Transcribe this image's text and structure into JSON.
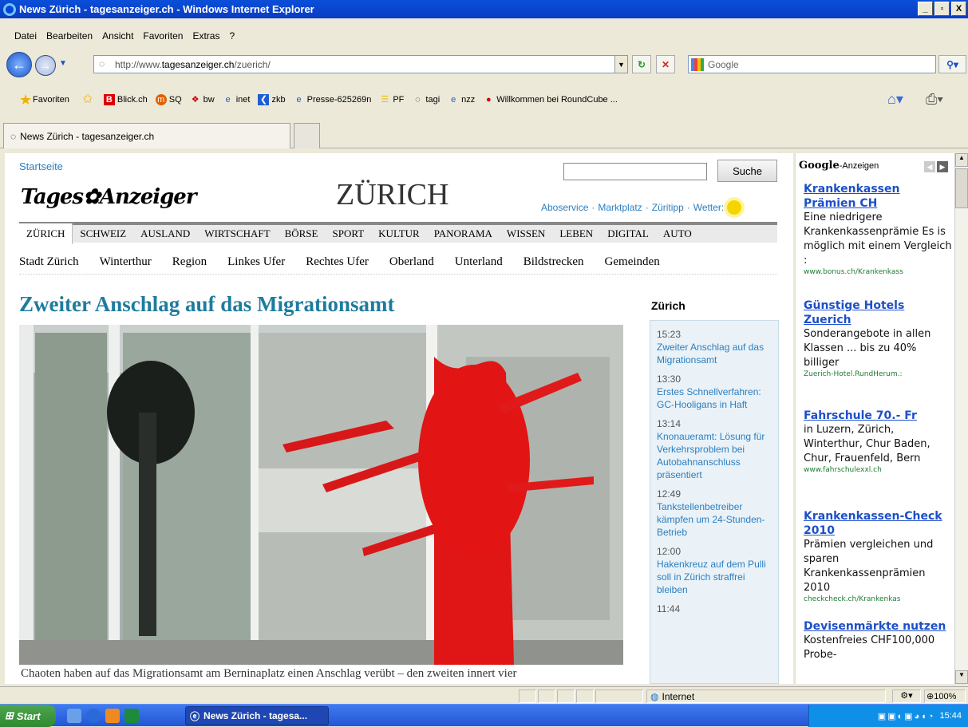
{
  "window": {
    "title": "News Zürich - tagesanzeiger.ch - Windows Internet Explorer",
    "controls": [
      "_",
      "▫",
      "X"
    ]
  },
  "menu": [
    "Datei",
    "Bearbeiten",
    "Ansicht",
    "Favoriten",
    "Extras",
    "?"
  ],
  "address": {
    "prefix": "http://www.",
    "domain": "tagesanzeiger.ch",
    "path": "/zuerich/"
  },
  "search": {
    "placeholder": "Google"
  },
  "favorites": {
    "button_label": "Favoriten",
    "links": [
      "Blick.ch",
      "SQ",
      "bw",
      "inet",
      "zkb",
      "Presse-625269n",
      "PF",
      "tagi",
      "nzz",
      "Willkommen bei RoundCube ..."
    ]
  },
  "tab": {
    "title": "News Zürich - tagesanzeiger.ch"
  },
  "page": {
    "startseite": "Startseite",
    "search_button": "Suche",
    "logo": "Tages✿Anzeiger",
    "region": "ZÜRICH",
    "services": [
      "Aboservice",
      "Marktplatz",
      "Züritipp",
      "Wetter:"
    ],
    "main_nav": [
      "ZÜRICH",
      "SCHWEIZ",
      "AUSLAND",
      "WIRTSCHAFT",
      "BÖRSE",
      "SPORT",
      "KULTUR",
      "PANORAMA",
      "WISSEN",
      "LEBEN",
      "DIGITAL",
      "AUTO"
    ],
    "sub_nav": [
      "Stadt Zürich",
      "Winterthur",
      "Region",
      "Linkes Ufer",
      "Rechtes Ufer",
      "Oberland",
      "Unterland",
      "Bildstrecken",
      "Gemeinden"
    ],
    "headline": "Zweiter Anschlag auf das Migrationsamt",
    "teaser": "Chaoten haben auf das Migrationsamt am Berninaplatz einen Anschlag verübt – den zweiten innert vier",
    "sidebar_title": "Zürich",
    "ticker": [
      {
        "time": "15:23",
        "title": "Zweiter Anschlag auf das Migrationsamt"
      },
      {
        "time": "13:30",
        "title": "Erstes Schnellverfahren: GC-Hooligans in Haft"
      },
      {
        "time": "13:14",
        "title": "Knonaueramt: Lösung für Verkehrsproblem bei Autobahnanschluss präsentiert"
      },
      {
        "time": "12:49",
        "title": "Tankstellenbetreiber kämpfen um 24-Stunden-Betrieb"
      },
      {
        "time": "12:00",
        "title": "Hakenkreuz auf dem Pulli soll in Zürich straffrei bleiben"
      },
      {
        "time": "11:44",
        "title": ""
      }
    ]
  },
  "ads": {
    "brand": "Google",
    "label": "-Anzeigen",
    "items": [
      {
        "title": "Krankenkassen Prämien CH",
        "text": "Eine niedrigere Krankenkassenprämie Es is möglich mit einem Vergleich :",
        "url": "www.bonus.ch/Krankenkass"
      },
      {
        "title": "Günstige Hotels Zuerich",
        "text": "Sonderangebote in allen Klassen ... bis zu 40% billiger",
        "url": "Zuerich-Hotel.RundHerum.:"
      },
      {
        "title": "Fahrschule 70.- Fr",
        "text": "in Luzern, Zürich, Winterthur, Chur Baden, Chur, Frauenfeld, Bern",
        "url": "www.fahrschulexxl.ch"
      },
      {
        "title": "Krankenkassen-Check 2010",
        "text": "Prämien vergleichen und sparen Krankenkassenprämien 2010",
        "url": "checkcheck.ch/Krankenkas"
      },
      {
        "title": "Devisenmärkte nutzen",
        "text": "Kostenfreies CHF100,000 Probe-",
        "url": ""
      }
    ]
  },
  "status": {
    "zone": "Internet",
    "zoom": "100%"
  },
  "taskbar": {
    "start": "Start",
    "item": "News Zürich - tagesa...",
    "clock": "15:44"
  },
  "colors": {
    "link": "#2a7ec2",
    "headline": "#1e7c9e",
    "ad_title": "#1e4fc9",
    "ad_url": "#1e7c33"
  }
}
